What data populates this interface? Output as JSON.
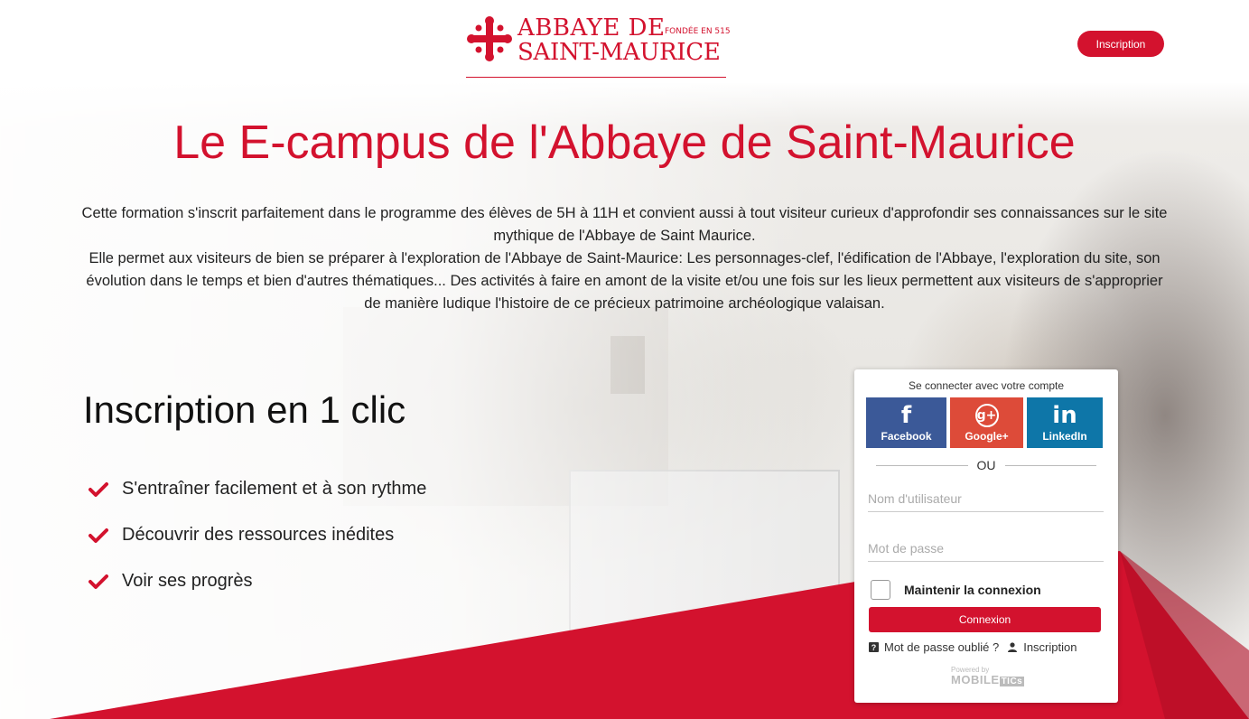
{
  "header": {
    "logo_line1": "ABBAYE DE",
    "logo_line2": "SAINT-MAURICE",
    "logo_founded": "FONDÉE EN 515",
    "inscription_button": "Inscription"
  },
  "hero": {
    "title": "Le E-campus de l'Abbaye de Saint-Maurice",
    "paragraph1": "Cette formation s'inscrit parfaitement dans le programme des élèves de 5H à 11H et convient aussi à tout visiteur curieux d'approfondir ses connaissances sur le site mythique de l'Abbaye de Saint Maurice.",
    "paragraph2": "Elle permet aux visiteurs de bien se préparer à l'exploration de l'Abbaye de Saint-Maurice: Les personnages-clef, l'édification de l'Abbaye, l'exploration du site, son évolution dans le temps et bien d'autres thématiques... Des activités à faire en amont de la visite et/ou une fois sur les lieux permettent aux visiteurs de s'approprier de manière ludique l'histoire de ce précieux patrimoine archéologique valaisan."
  },
  "features": {
    "title": "Inscription en 1 clic",
    "items": [
      {
        "label": "S'entraîner facilement et à son rythme",
        "icon": "check-icon"
      },
      {
        "label": "Découvrir des ressources inédites",
        "icon": "check-icon"
      },
      {
        "label": "Voir ses progrès",
        "icon": "check-icon"
      }
    ]
  },
  "login": {
    "heading": "Se connecter avec votre compte",
    "social": [
      {
        "label": "Facebook",
        "glyph": "f",
        "icon": "facebook-icon",
        "color": "#3b5998"
      },
      {
        "label": "Google+",
        "glyph": "g+",
        "icon": "google-plus-icon",
        "color": "#dd4b39"
      },
      {
        "label": "LinkedIn",
        "glyph": "in",
        "icon": "linkedin-icon",
        "color": "#0e76a8"
      }
    ],
    "or_text": "OU",
    "username_placeholder": "Nom d'utilisateur",
    "password_placeholder": "Mot de passe",
    "remember_label": "Maintenir la connexion",
    "submit_label": "Connexion",
    "forgot_label": "Mot de passe oublié ?",
    "forgot_icon_glyph": "?",
    "register_label": "Inscription",
    "powered_small": "Powered by",
    "powered_brand": "MOBILE",
    "powered_brand_suffix": "TICs"
  },
  "colors": {
    "accent": "#d3122e",
    "facebook": "#3b5998",
    "google": "#dd4b39",
    "linkedin": "#0e76a8"
  }
}
